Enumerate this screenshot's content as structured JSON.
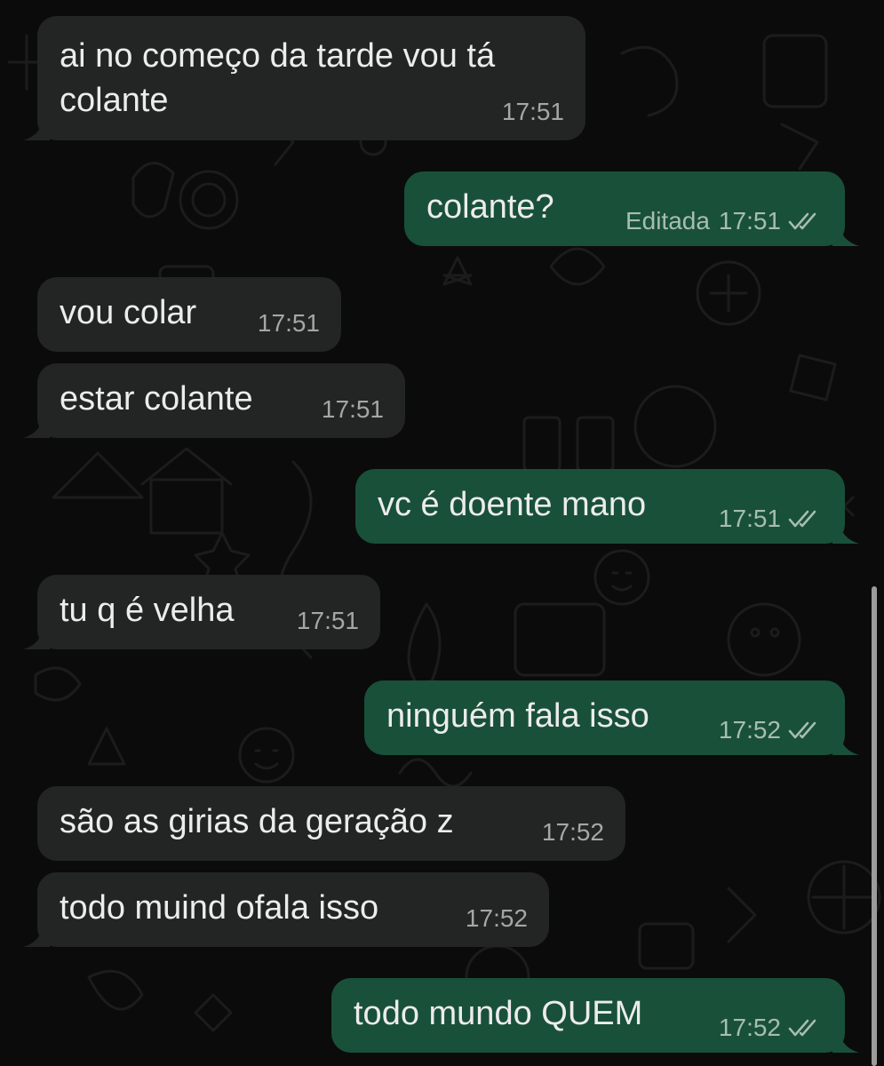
{
  "colors": {
    "background": "#0b0b0b",
    "incoming_bubble": "#232424",
    "outgoing_bubble": "#195039",
    "timestamp": "#a3a7a5",
    "read_ticks": "#a7bdb1"
  },
  "messages": [
    {
      "direction": "incoming",
      "text_lines": [
        "ai no começo da tarde vou tá",
        "colante"
      ],
      "time": "17:51"
    },
    {
      "direction": "outgoing",
      "text": "colante?",
      "edited_label": "Editada",
      "time": "17:51",
      "status_icon": "double-check-icon"
    },
    {
      "direction": "incoming",
      "text": "vou colar",
      "time": "17:51"
    },
    {
      "direction": "incoming",
      "text": "estar colante",
      "time": "17:51"
    },
    {
      "direction": "outgoing",
      "text": "vc é doente mano",
      "time": "17:51",
      "status_icon": "double-check-icon"
    },
    {
      "direction": "incoming",
      "text": "tu q é velha",
      "time": "17:51"
    },
    {
      "direction": "outgoing",
      "text": "ninguém fala isso",
      "time": "17:52",
      "status_icon": "double-check-icon"
    },
    {
      "direction": "incoming",
      "text": "são as girias da geração z",
      "time": "17:52"
    },
    {
      "direction": "incoming",
      "text": "todo muind ofala isso",
      "time": "17:52"
    },
    {
      "direction": "outgoing",
      "text": "todo mundo QUEM",
      "time": "17:52",
      "status_icon": "double-check-icon"
    }
  ]
}
